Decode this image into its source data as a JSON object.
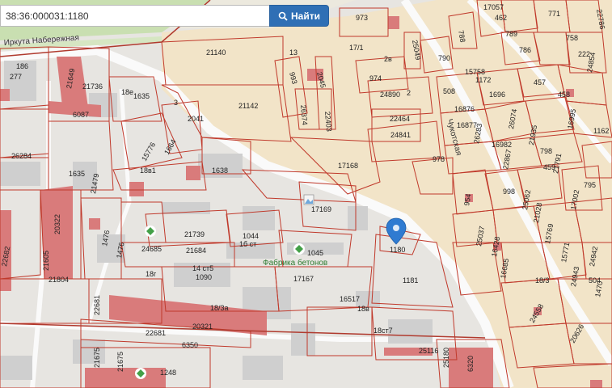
{
  "search": {
    "query": "38:36:000031:1180",
    "button_label": "Найти",
    "icon": "search-icon"
  },
  "map": {
    "streets": {
      "embankment": "Иркута Набережная",
      "chukotskaya": "Чукотская"
    },
    "poi": {
      "concrete_factory": "Фабрика бетонов"
    },
    "selected_parcel": "1180",
    "parcels": {
      "p277": "277",
      "p186": "186",
      "p21649": "21649",
      "p21736": "21736",
      "p6087": "6087",
      "p18e": "18е",
      "p1635a": "1635",
      "p3": "3",
      "p21140": "21140",
      "p13": "13",
      "p993": "993",
      "p2045": "2045",
      "p21142": "21142",
      "p26374": "26374",
      "p22403": "22403",
      "p973": "973",
      "p17_1": "17/1",
      "p2v": "2в",
      "p974": "974",
      "p24890": "24890",
      "p2": "2",
      "p22464": "22464",
      "p24841": "24841",
      "p25049": "25049",
      "p790": "790",
      "p788": "788",
      "p17057": "17057",
      "p462": "462",
      "p789": "789",
      "p771": "771",
      "p758": "758",
      "p786": "786",
      "p222": "222",
      "p22786": "22786",
      "p508": "508",
      "p15758": "15758",
      "p1172": "1172",
      "p16876": "16876",
      "p1696": "1696",
      "p457": "457",
      "p24854": "24854",
      "p16877": "16877",
      "p26283": "26283",
      "p26074": "26074",
      "p458": "458",
      "p16995": "16995",
      "p1162": "1162",
      "p26284": "26284",
      "p15776": "15776",
      "p1664": "1664",
      "p2041": "2041",
      "p1638": "1638",
      "p18v1": "18в1",
      "p1635b": "1635",
      "p21479": "21479",
      "p17168": "17168",
      "p978": "978",
      "p16982": "16982",
      "p22867": "22867",
      "p21935": "21935",
      "p798": "798",
      "p459": "459",
      "p21791": "21791",
      "p795": "795",
      "p20322": "20322",
      "p16982b": "16982",
      "p17169": "17169",
      "p954": "954",
      "p998": "998",
      "p25062": "25062",
      "p21028": "21028",
      "p17002": "17002",
      "p24685": "24685",
      "p21739": "21739",
      "p21684": "21684",
      "p1044": "1044",
      "p1bst": "1б ст",
      "p1045": "1045",
      "p1476a": "1476",
      "p1476b": "1476",
      "p21605": "21605",
      "p22682": "22682",
      "p25037": "25037",
      "p15769": "15769",
      "p16428": "16428",
      "p15771": "15771",
      "p24942": "24942",
      "p16685": "16685",
      "p18_3": "18/3",
      "p504": "504",
      "p24943": "24943",
      "p1470": "1470",
      "p21804": "21804",
      "p18g": "18г",
      "p14st5": "14 ст5",
      "p1090": "1090",
      "p17167": "17167",
      "p1181": "1181",
      "p22681a": "22681",
      "p16517": "16517",
      "p18v": "18в",
      "p24558": "24558",
      "p18za": "18/3а",
      "p20321": "20321",
      "p22681b": "22681",
      "p18st7": "18ст7",
      "p6350": "6350",
      "p25116": "25116",
      "p20626": "20626",
      "p21675a": "21675",
      "p21675b": "21675",
      "p1248": "1248",
      "p25180": "25180",
      "p6320": "6320"
    }
  }
}
